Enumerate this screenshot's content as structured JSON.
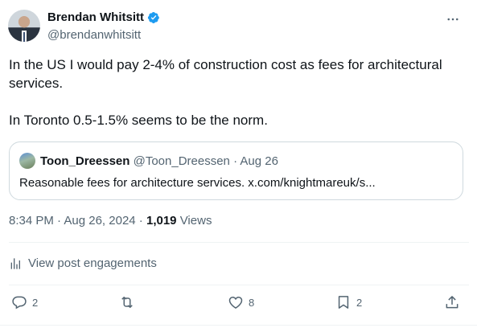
{
  "author": {
    "name": "Brendan Whitsitt",
    "handle": "@brendanwhitsitt",
    "verified": true
  },
  "tweet": {
    "text": "In the US I would pay 2-4% of construction cost as fees for architectural services.\n\nIn Toronto 0.5-1.5% seems to be the norm."
  },
  "quote": {
    "name": "Toon_Dreessen",
    "handle": "@Toon_Dreessen",
    "separator": " · ",
    "date": "Aug 26",
    "text": "Reasonable fees for architecture services. x.com/knightmareuk/s..."
  },
  "meta": {
    "time": "8:34 PM",
    "separator1": " · ",
    "date": "Aug 26, 2024",
    "separator2": " · ",
    "views_count": "1,019",
    "views_label": " Views"
  },
  "engagements_label": "View post engagements",
  "actions": {
    "replies": "2",
    "retweets": "",
    "likes": "8",
    "bookmarks": "2"
  },
  "colors": {
    "text": "#0f1419",
    "muted": "#536471",
    "verified": "#1d9bf0",
    "border": "#cfd9de"
  },
  "icons": [
    "verified-badge-icon",
    "more-options-icon",
    "analytics-icon",
    "reply-icon",
    "retweet-icon",
    "like-icon",
    "bookmark-icon",
    "share-icon"
  ]
}
